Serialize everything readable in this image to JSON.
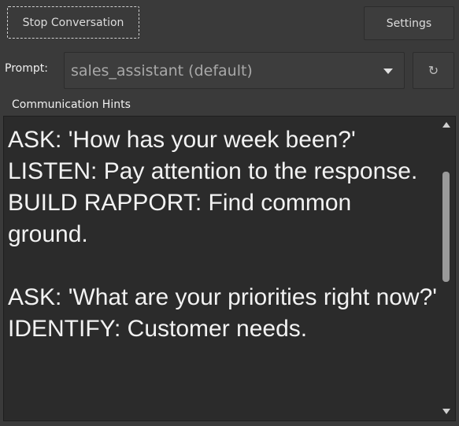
{
  "toolbar": {
    "stop_label": "Stop Conversation",
    "settings_label": "Settings"
  },
  "prompt": {
    "label": "Prompt:",
    "selected": "sales_assistant (default)",
    "refresh_icon": "refresh-icon"
  },
  "hints": {
    "label": "Communication Hints",
    "text": "ASK: 'How has your week been?'\nLISTEN: Pay attention to the response.\nBUILD RAPPORT: Find common ground.\n\nASK: 'What are your priorities right now?'\nIDENTIFY: Customer needs."
  },
  "colors": {
    "background": "#3a3a3a",
    "text_area_bg": "#2b2b2b",
    "text": "#f2f2f2"
  }
}
